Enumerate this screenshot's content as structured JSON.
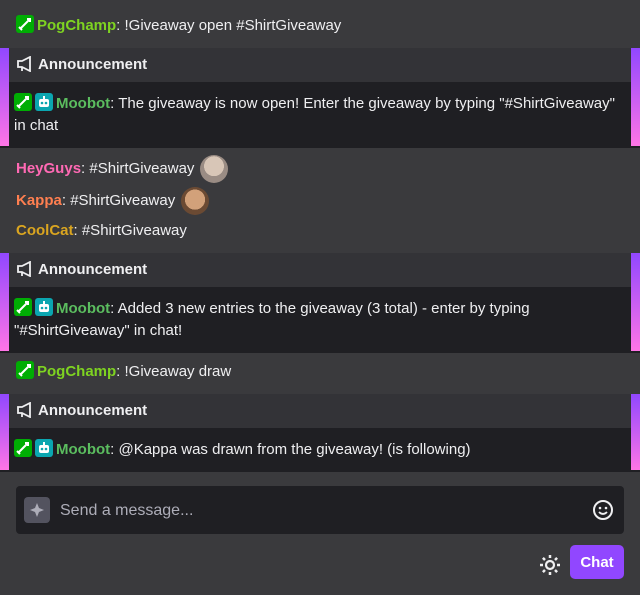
{
  "messages": [
    {
      "user": "PogChamp",
      "user_color": "#7ed321",
      "text": "!Giveaway open #ShirtGiveaway"
    },
    {
      "user": "HeyGuys",
      "user_color": "#ff69b4",
      "text": "#ShirtGiveaway"
    },
    {
      "user": "Kappa",
      "user_color": "#ff7f50",
      "text": "#ShirtGiveaway"
    },
    {
      "user": "CoolCat",
      "user_color": "#daa520",
      "text": "#ShirtGiveaway"
    },
    {
      "user": "PogChamp",
      "user_color": "#7ed321",
      "text": "!Giveaway draw"
    }
  ],
  "announcements": [
    {
      "header": "Announcement",
      "user": "Moobot",
      "user_color": "#5bbd5f",
      "text": "The giveaway is now open! Enter the giveaway by typing \"#ShirtGiveaway\" in chat"
    },
    {
      "header": "Announcement",
      "user": "Moobot",
      "user_color": "#5bbd5f",
      "text": "Added 3 new entries to the giveaway (3 total) - enter by typing \"#ShirtGiveaway\" in chat!"
    },
    {
      "header": "Announcement",
      "user": "Moobot",
      "user_color": "#5bbd5f",
      "text": "@Kappa was drawn from the giveaway! (is following)"
    }
  ],
  "input": {
    "placeholder": "Send a message..."
  },
  "chat_button": "Chat",
  "icons": {
    "announcement": "megaphone-icon",
    "mod": "sword-icon",
    "bot": "robot-icon",
    "settings": "gear-icon",
    "emoji": "smiley-icon",
    "spark": "sparkle-icon"
  }
}
